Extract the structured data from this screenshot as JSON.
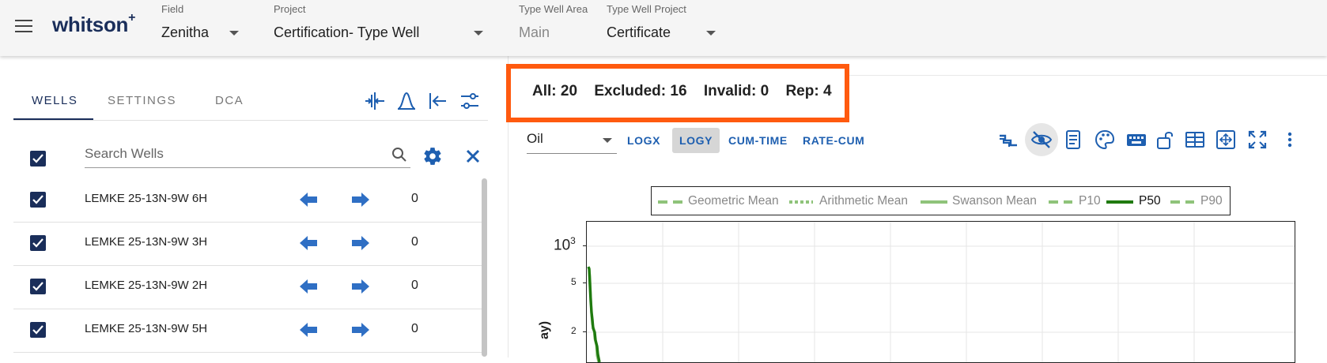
{
  "app": {
    "logo": "whitson",
    "logo_sup": "+"
  },
  "header": {
    "field": {
      "label": "Field",
      "value": "Zenitha"
    },
    "project": {
      "label": "Project",
      "value": "Certification- Type Well"
    },
    "type_well_area": {
      "label": "Type Well Area",
      "value": "Main"
    },
    "type_well_project": {
      "label": "Type Well Project",
      "value": "Certificate"
    }
  },
  "tabs": [
    {
      "label": "WELLS"
    },
    {
      "label": "SETTINGS"
    },
    {
      "label": "DCA"
    }
  ],
  "search": {
    "placeholder": "Search Wells"
  },
  "wells": [
    {
      "name": "LEMKE 25-13N-9W 6H",
      "value": "0"
    },
    {
      "name": "LEMKE 25-13N-9W 3H",
      "value": "0"
    },
    {
      "name": "LEMKE 25-13N-9W 2H",
      "value": "0"
    },
    {
      "name": "LEMKE 25-13N-9W 5H",
      "value": "0"
    }
  ],
  "stats": {
    "all": "All: 20",
    "excluded": "Excluded: 16",
    "invalid": "Invalid: 0",
    "rep": "Rep: 4"
  },
  "toolbar": {
    "phase": "Oil",
    "buttons": [
      {
        "label": "LOGX"
      },
      {
        "label": "LOGY"
      },
      {
        "label": "CUM-TIME"
      },
      {
        "label": "RATE-CUM"
      }
    ],
    "active": "LOGY"
  },
  "legend": [
    {
      "label": "Geometric Mean"
    },
    {
      "label": "Arithmetic Mean"
    },
    {
      "label": "Swanson Mean"
    },
    {
      "label": "P10"
    },
    {
      "label": "P50"
    },
    {
      "label": "P90"
    }
  ],
  "axis": {
    "y_ticks": [
      {
        "label": "5"
      },
      {
        "label": "2"
      }
    ],
    "y_top_base": "10",
    "y_top_exp": "3",
    "ylabel_visible": "ay)"
  },
  "colors": {
    "accent": "#1a2e5a",
    "button": "#1e5fb0",
    "highlight": "#ff5a0f",
    "p50": "#1f7a0f",
    "light_green": "#8fc37a"
  }
}
